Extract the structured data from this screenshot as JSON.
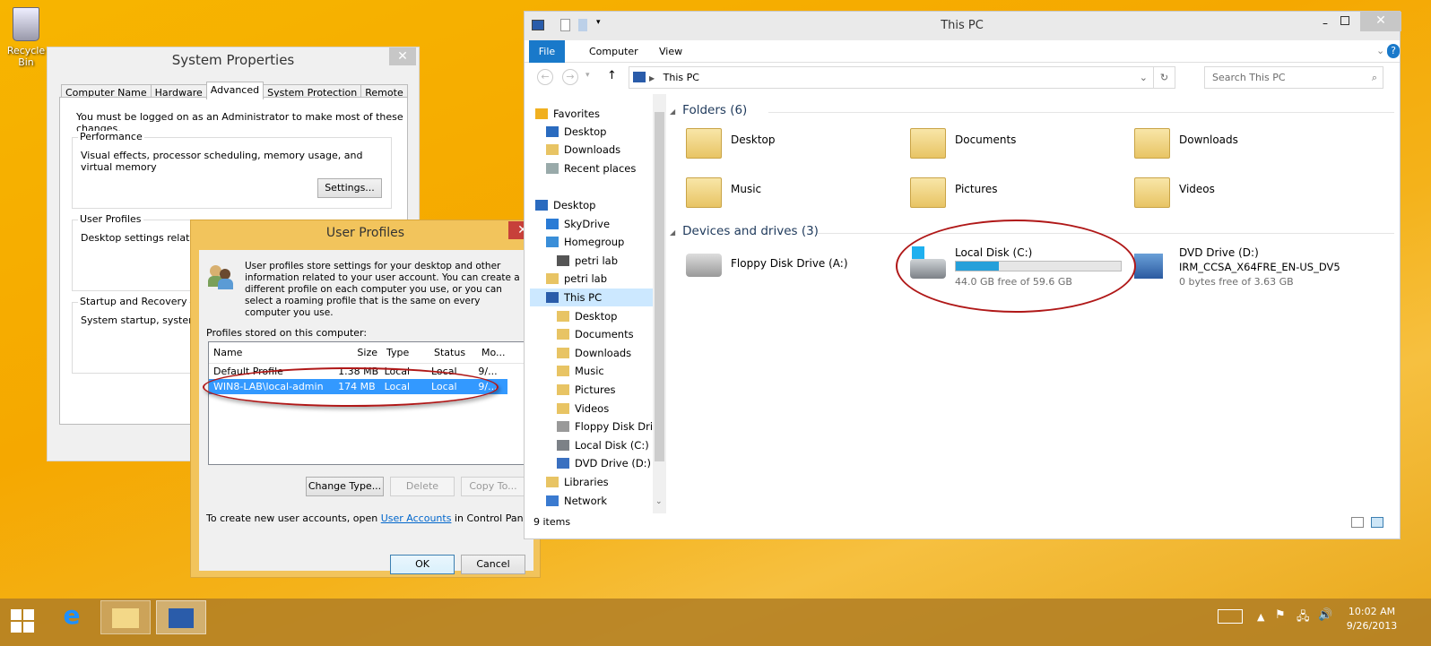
{
  "desktop": {
    "recycle_bin_label": "Recycle Bin"
  },
  "system_properties": {
    "title": "System Properties",
    "tabs": [
      "Computer Name",
      "Hardware",
      "Advanced",
      "System Protection",
      "Remote"
    ],
    "active_tab": "Advanced",
    "admin_note": "You must be logged on as an Administrator to make most of these changes.",
    "performance": {
      "label": "Performance",
      "text": "Visual effects, processor scheduling, memory usage, and virtual memory",
      "button": "Settings..."
    },
    "user_profiles": {
      "label": "User Profiles",
      "text": "Desktop settings related to"
    },
    "startup": {
      "label": "Startup and Recovery",
      "text": "System startup, system failu"
    },
    "close": "✕"
  },
  "user_profiles_dialog": {
    "title": "User Profiles",
    "close": "✕",
    "description": "User profiles store settings for your desktop and other information related to your user account. You can create a different profile on each computer you use, or you can select a roaming profile that is the same on every computer you use.",
    "list_label": "Profiles stored on this computer:",
    "columns": [
      "Name",
      "Size",
      "Type",
      "Status",
      "Mo..."
    ],
    "rows": [
      {
        "name": "Default Profile",
        "size": "1.38 MB",
        "type": "Local",
        "status": "Local",
        "modified": "9/..."
      },
      {
        "name": "WIN8-LAB\\local-admin",
        "size": "174 MB",
        "type": "Local",
        "status": "Local",
        "modified": "9/..."
      }
    ],
    "selected_row": 1,
    "buttons": {
      "change_type": "Change Type...",
      "delete": "Delete",
      "copy_to": "Copy To...",
      "ok": "OK",
      "cancel": "Cancel"
    },
    "footer_pre": "To create new user accounts, open ",
    "footer_link": "User Accounts",
    "footer_post": " in Control Panel."
  },
  "explorer": {
    "title": "This PC",
    "ribbon_tabs": [
      "File",
      "Computer",
      "View"
    ],
    "address": "This PC",
    "search_placeholder": "Search This PC",
    "nav": [
      {
        "label": "Favorites",
        "level": 0,
        "icon": "star"
      },
      {
        "label": "Desktop",
        "level": 1,
        "icon": "desktop"
      },
      {
        "label": "Downloads",
        "level": 1,
        "icon": "folder"
      },
      {
        "label": "Recent places",
        "level": 1,
        "icon": "recent"
      },
      {
        "label": "Desktop",
        "level": 0,
        "icon": "desktop"
      },
      {
        "label": "SkyDrive",
        "level": 1,
        "icon": "cloud"
      },
      {
        "label": "Homegroup",
        "level": 1,
        "icon": "homegroup"
      },
      {
        "label": "petri lab",
        "level": 2,
        "icon": "user"
      },
      {
        "label": "petri lab",
        "level": 1,
        "icon": "folder"
      },
      {
        "label": "This PC",
        "level": 1,
        "icon": "pc",
        "selected": true
      },
      {
        "label": "Desktop",
        "level": 2,
        "icon": "folder"
      },
      {
        "label": "Documents",
        "level": 2,
        "icon": "folder"
      },
      {
        "label": "Downloads",
        "level": 2,
        "icon": "folder"
      },
      {
        "label": "Music",
        "level": 2,
        "icon": "folder"
      },
      {
        "label": "Pictures",
        "level": 2,
        "icon": "folder"
      },
      {
        "label": "Videos",
        "level": 2,
        "icon": "folder"
      },
      {
        "label": "Floppy Disk Dri",
        "level": 2,
        "icon": "floppy"
      },
      {
        "label": "Local Disk (C:)",
        "level": 2,
        "icon": "disk"
      },
      {
        "label": "DVD Drive (D:)",
        "level": 2,
        "icon": "dvd"
      },
      {
        "label": "Libraries",
        "level": 1,
        "icon": "folder"
      },
      {
        "label": "Network",
        "level": 1,
        "icon": "network"
      }
    ],
    "folders_header": "Folders (6)",
    "folders": [
      "Desktop",
      "Documents",
      "Downloads",
      "Music",
      "Pictures",
      "Videos"
    ],
    "drives_header": "Devices and drives (3)",
    "drives": [
      {
        "name": "Floppy Disk Drive (A:)"
      },
      {
        "name": "Local Disk (C:)",
        "free": "44.0 GB free of 59.6 GB",
        "used_fraction": 0.26
      },
      {
        "name": "DVD Drive (D:)",
        "label": "IRM_CCSA_X64FRE_EN-US_DV5",
        "free": "0 bytes free of 3.63 GB"
      }
    ],
    "status": "9 items"
  },
  "taskbar": {
    "time": "10:02 AM",
    "date": "9/26/2013"
  },
  "colors": {
    "accent": "#1979ca",
    "selection": "#3399ff",
    "annotation": "#b01818",
    "drive_bar": "#26a0da"
  }
}
